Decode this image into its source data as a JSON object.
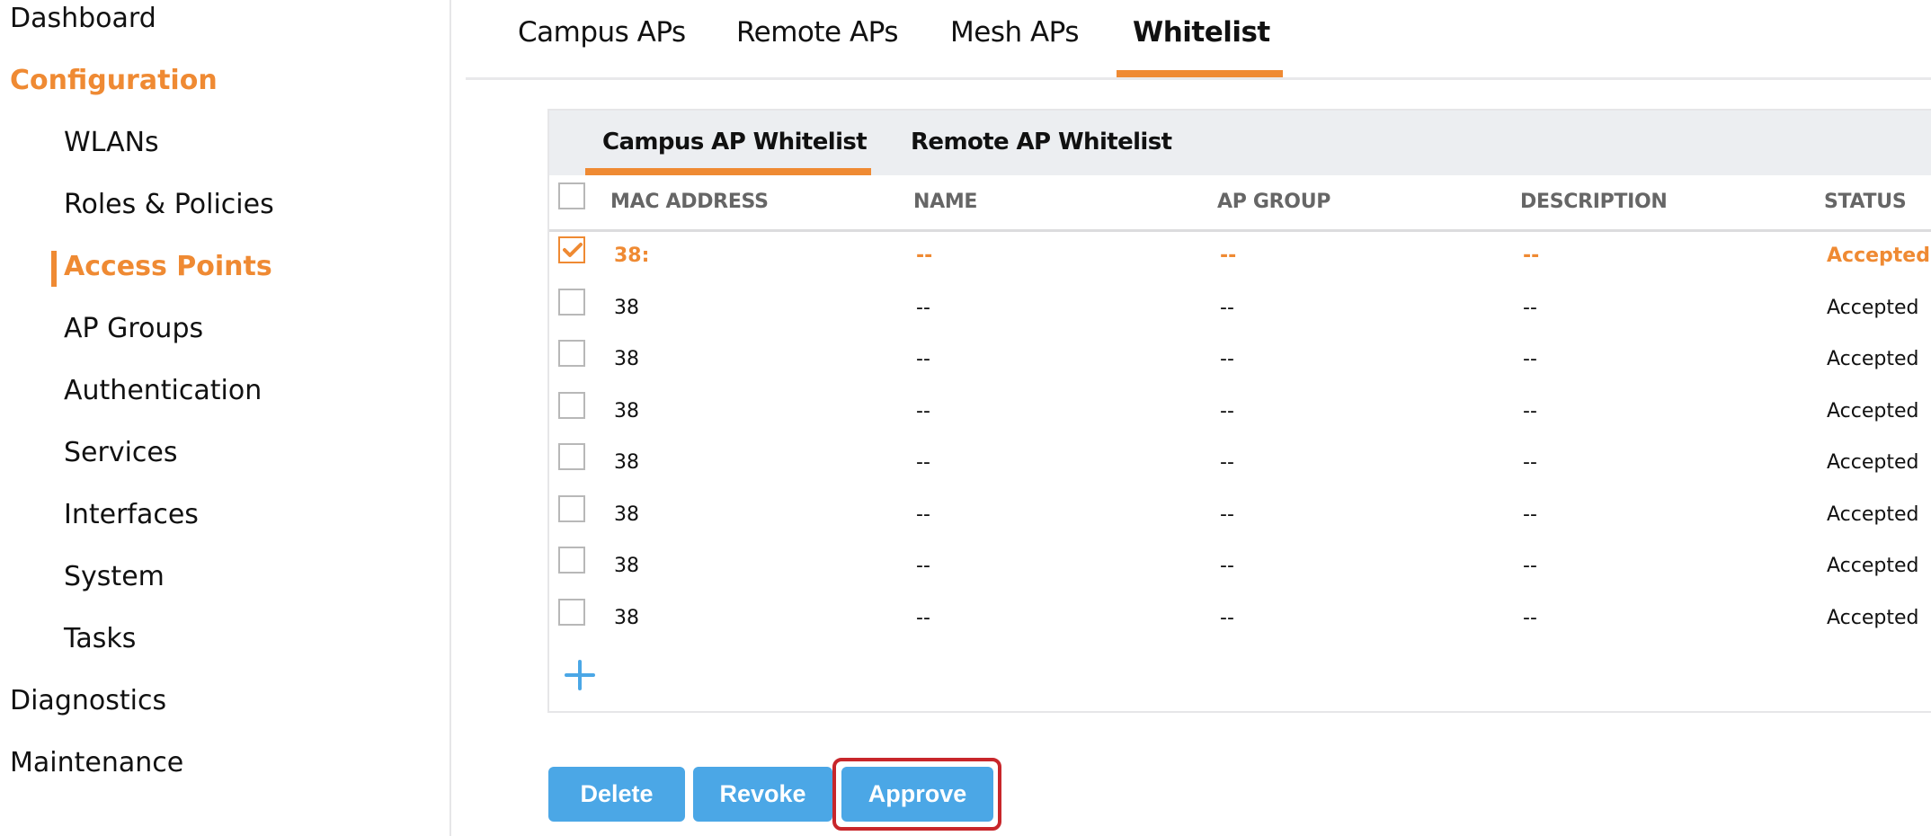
{
  "sidebar": {
    "items": [
      {
        "label": "Dashboard",
        "level": 0,
        "active": false
      },
      {
        "label": "Configuration",
        "level": 0,
        "active": true
      },
      {
        "label": "WLANs",
        "level": 1,
        "active": false
      },
      {
        "label": "Roles & Policies",
        "level": 1,
        "active": false
      },
      {
        "label": "Access Points",
        "level": 1,
        "active": true
      },
      {
        "label": "AP Groups",
        "level": 1,
        "active": false
      },
      {
        "label": "Authentication",
        "level": 1,
        "active": false
      },
      {
        "label": "Services",
        "level": 1,
        "active": false
      },
      {
        "label": "Interfaces",
        "level": 1,
        "active": false
      },
      {
        "label": "System",
        "level": 1,
        "active": false
      },
      {
        "label": "Tasks",
        "level": 1,
        "active": false
      },
      {
        "label": "Diagnostics",
        "level": 0,
        "active": false
      },
      {
        "label": "Maintenance",
        "level": 0,
        "active": false
      }
    ]
  },
  "tabs": [
    {
      "label": "Campus APs",
      "active": false
    },
    {
      "label": "Remote APs",
      "active": false
    },
    {
      "label": "Mesh APs",
      "active": false
    },
    {
      "label": "Whitelist",
      "active": true
    }
  ],
  "subtabs": [
    {
      "label": "Campus AP Whitelist",
      "active": true
    },
    {
      "label": "Remote AP Whitelist",
      "active": false
    }
  ],
  "table": {
    "columns": [
      "MAC ADDRESS",
      "NAME",
      "AP GROUP",
      "DESCRIPTION",
      "STATUS"
    ],
    "rows": [
      {
        "checked": true,
        "mac": "38:",
        "name": "--",
        "ap_group": "--",
        "description": "--",
        "status": "Accepted"
      },
      {
        "checked": false,
        "mac": "38",
        "name": "--",
        "ap_group": "--",
        "description": "--",
        "status": "Accepted"
      },
      {
        "checked": false,
        "mac": "38",
        "name": "--",
        "ap_group": "--",
        "description": "--",
        "status": "Accepted"
      },
      {
        "checked": false,
        "mac": "38",
        "name": "--",
        "ap_group": "--",
        "description": "--",
        "status": "Accepted"
      },
      {
        "checked": false,
        "mac": "38",
        "name": "--",
        "ap_group": "--",
        "description": "--",
        "status": "Accepted"
      },
      {
        "checked": false,
        "mac": "38",
        "name": "--",
        "ap_group": "--",
        "description": "--",
        "status": "Accepted"
      },
      {
        "checked": false,
        "mac": "38",
        "name": "--",
        "ap_group": "--",
        "description": "--",
        "status": "Accepted"
      },
      {
        "checked": false,
        "mac": "38",
        "name": "--",
        "ap_group": "--",
        "description": "--",
        "status": "Accepted"
      }
    ],
    "add_icon": "plus-icon"
  },
  "actions": {
    "delete_label": "Delete",
    "revoke_label": "Revoke",
    "approve_label": "Approve"
  },
  "colors": {
    "accent": "#ef8a33",
    "button": "#4ba7e6",
    "highlight": "#c8262b"
  }
}
